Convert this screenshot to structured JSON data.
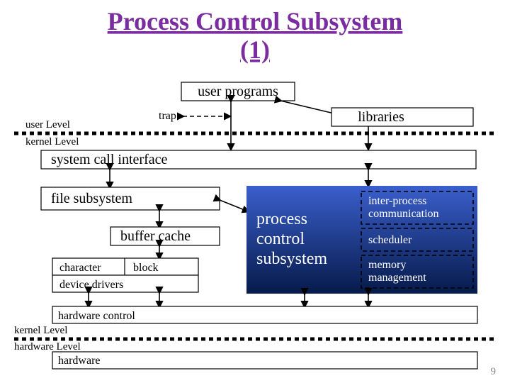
{
  "title1": "Process Control Subsystem",
  "title2": "(1)",
  "userprograms": "user programs",
  "trap": "trap",
  "libraries": "libraries",
  "userLevel": "user Level",
  "kernelLevel": "kernel Level",
  "sci": "system call interface",
  "filesub": "file subsystem",
  "buffercache": "buffer cache",
  "character": "character",
  "block": "block",
  "devicedrivers": "device drivers",
  "pcs1": "process",
  "pcs2": "control",
  "pcs3": "subsystem",
  "ipc1": "inter-process",
  "ipc2": "communication",
  "scheduler": "scheduler",
  "mem1": "memory",
  "mem2": "management",
  "hardwarecontrol": "hardware control",
  "kernelLevel2": "kernel Level",
  "hardwareLevel": "hardware Level",
  "hardware": "hardware",
  "pagenum": "9"
}
